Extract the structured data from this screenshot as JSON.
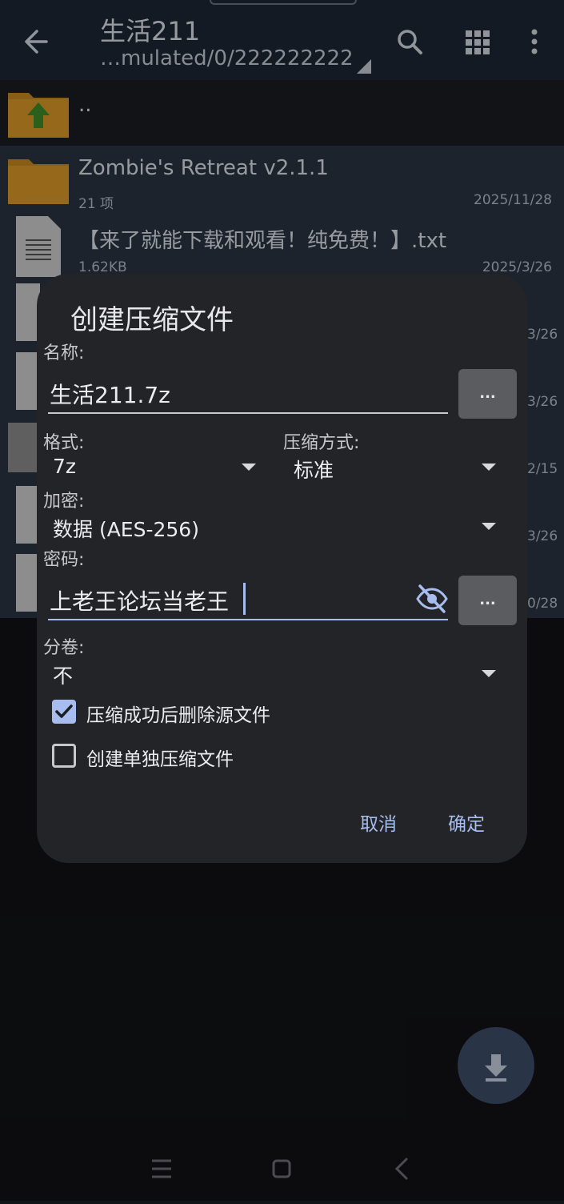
{
  "appbar": {
    "title": "生活211",
    "path": "…mulated/0/222222222",
    "icons": [
      "back-arrow-icon",
      "search-icon",
      "grid-view-icon",
      "more-vert-icon"
    ]
  },
  "files": [
    {
      "name": "..",
      "icon": "folder-up-icon"
    },
    {
      "name": "Zombie's Retreat v2.1.1",
      "meta": "21 项",
      "date": "2025/11/28",
      "icon": "folder-icon"
    },
    {
      "name": "【来了就能下载和观看！纯免费！】.txt",
      "meta": "1.62KB",
      "date": "2025/3/26",
      "icon": "text-file-icon"
    },
    {
      "date_fragment": "3/26"
    },
    {
      "date_fragment": "3/26"
    },
    {
      "date_fragment": "2/15"
    },
    {
      "date_fragment": "3/26"
    },
    {
      "date_fragment": "0/28"
    }
  ],
  "dialog": {
    "title": "创建压缩文件",
    "name_label": "名称:",
    "name_value": "生活211.7z",
    "browse_button": "...",
    "format_label": "格式:",
    "format_value": "7z",
    "method_label": "压缩方式:",
    "method_value": "标准",
    "encryption_label": "加密:",
    "encryption_value": "数据 (AES-256)",
    "password_label": "密码:",
    "password_value": "上老王论坛当老王",
    "password_button": "...",
    "split_label": "分卷:",
    "split_value": "不",
    "delete_source_label": "压缩成功后删除源文件",
    "delete_source_checked": true,
    "separate_archives_label": "创建单独压缩文件",
    "separate_archives_checked": false,
    "cancel": "取消",
    "ok": "确定"
  },
  "colors": {
    "accent": "#a7bdf0",
    "dialog_bg": "#232428",
    "appbar_bg": "#1d2735"
  }
}
